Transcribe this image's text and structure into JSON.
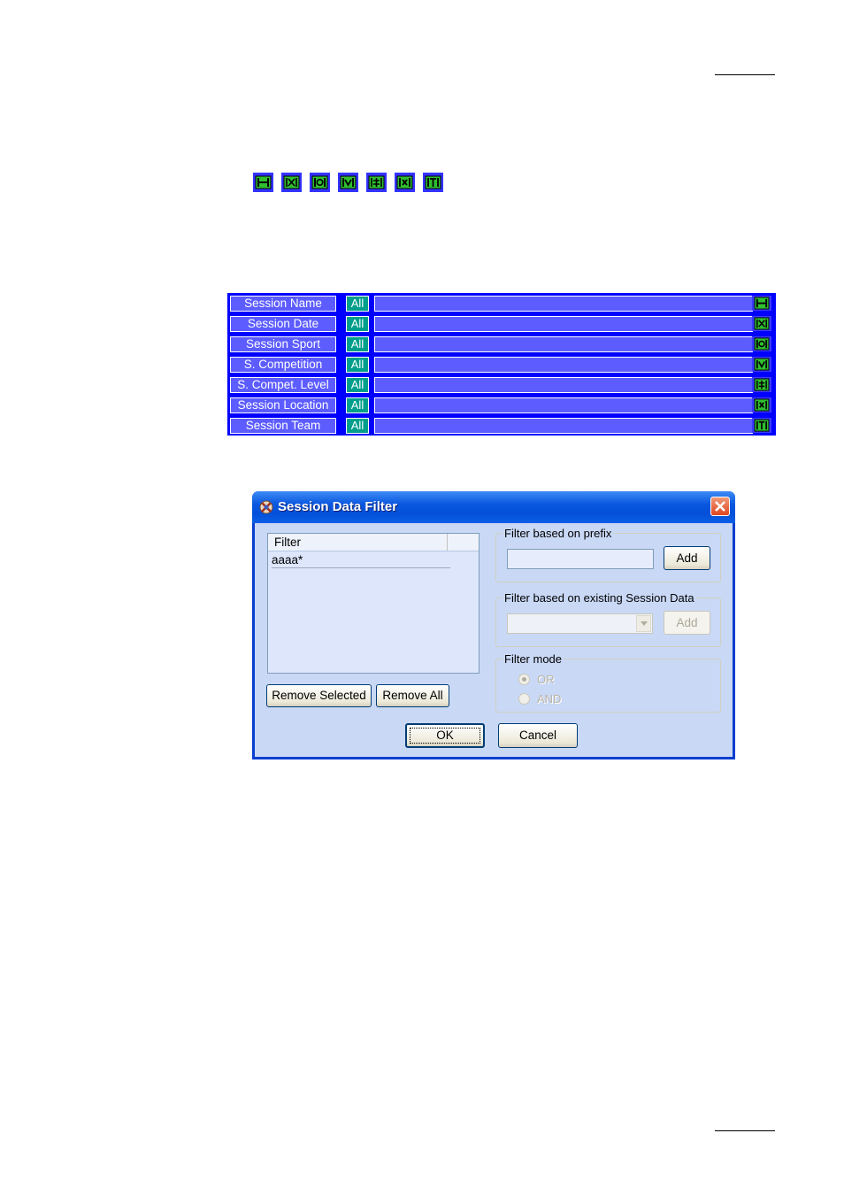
{
  "toolbar_icons": [
    "filter-name-icon",
    "filter-date-icon",
    "filter-sport-icon",
    "filter-competition-icon",
    "filter-level-icon",
    "filter-location-icon",
    "filter-team-icon"
  ],
  "session_panel": {
    "rows": [
      {
        "label": "Session Name",
        "all": "All",
        "icon": "filter-name-icon"
      },
      {
        "label": "Session Date",
        "all": "All",
        "icon": "filter-date-icon"
      },
      {
        "label": "Session Sport",
        "all": "All",
        "icon": "filter-sport-icon"
      },
      {
        "label": "S. Competition",
        "all": "All",
        "icon": "filter-competition-icon"
      },
      {
        "label": "S. Compet. Level",
        "all": "All",
        "icon": "filter-level-icon"
      },
      {
        "label": "Session Location",
        "all": "All",
        "icon": "filter-location-icon"
      },
      {
        "label": "Session Team",
        "all": "All",
        "icon": "filter-team-icon"
      }
    ],
    "colors": {
      "frame": "#0000ff",
      "cell": "#5c5cff",
      "all": "#009e8c"
    }
  },
  "dialog": {
    "title": "Session Data Filter",
    "list": {
      "header": "Filter",
      "items": [
        "aaaa*"
      ]
    },
    "remove_selected_label": "Remove Selected",
    "remove_all_label": "Remove All",
    "prefix_group": {
      "label": "Filter based on prefix",
      "input_value": "",
      "add_label": "Add"
    },
    "existing_group": {
      "label": "Filter based on existing Session Data",
      "selected": "",
      "add_label": "Add"
    },
    "mode_group": {
      "label": "Filter mode",
      "options": [
        "OR",
        "AND"
      ],
      "selected": "OR"
    },
    "ok_label": "OK",
    "cancel_label": "Cancel"
  }
}
